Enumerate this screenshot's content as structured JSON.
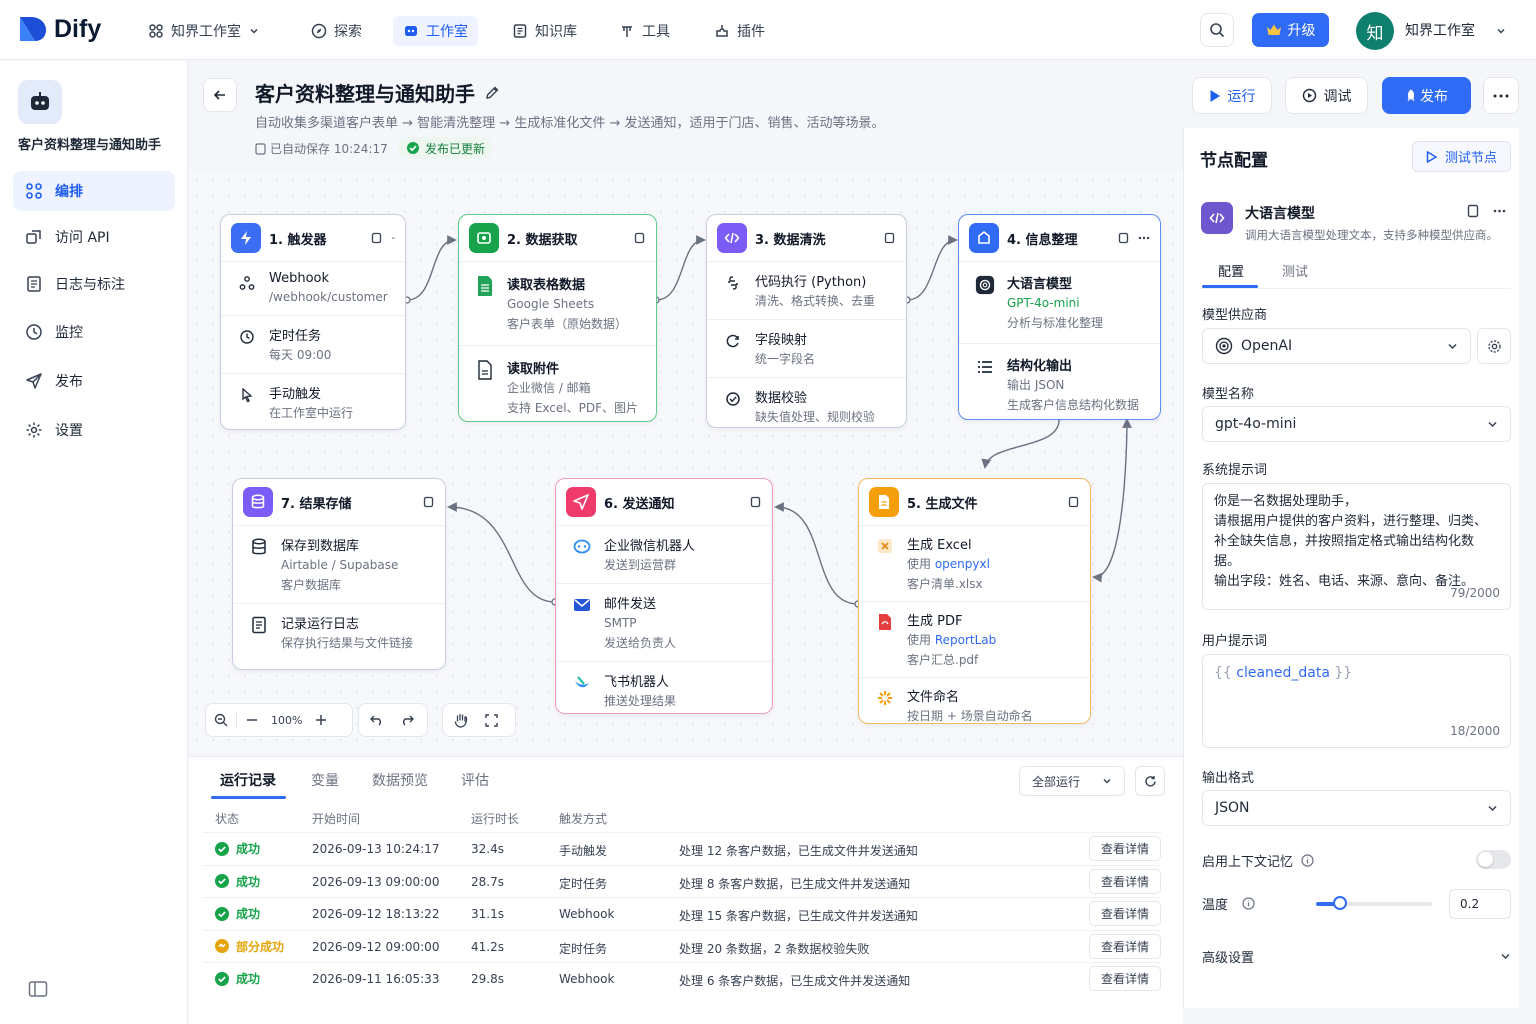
{
  "brand": {
    "name": "Dify",
    "accent": "#2f6bf5"
  },
  "topnav": {
    "workspace": "知界工作室",
    "items": [
      {
        "label": "探索"
      },
      {
        "label": "工作室"
      },
      {
        "label": "知识库"
      },
      {
        "label": "工具"
      },
      {
        "label": "插件"
      }
    ],
    "active": "工作室",
    "upgrade": "升级",
    "user_initial": "知",
    "user_name": "知界工作室"
  },
  "sidebar": {
    "app_name": "客户资料整理与通知助手",
    "items": [
      {
        "label": "编排",
        "icon": "orchestrate-icon"
      },
      {
        "label": "访问 API",
        "icon": "api-icon"
      },
      {
        "label": "日志与标注",
        "icon": "log-icon"
      },
      {
        "label": "监控",
        "icon": "monitor-icon"
      },
      {
        "label": "发布",
        "icon": "publish-icon"
      },
      {
        "label": "设置",
        "icon": "settings-icon"
      }
    ]
  },
  "header": {
    "title": "客户资料整理与通知助手",
    "description": "自动收集多渠道客户表单 → 智能清洗整理 → 生成标准化文件 → 发送通知，适用于门店、销售、活动等场景。",
    "autosave": "已自动保存 10:24:17",
    "publish_status": "发布已更新",
    "run": "运行",
    "debug": "调试",
    "publish": "发布"
  },
  "nodes": {
    "n1": {
      "title": "1. 触发器",
      "color": "#3b6ef5",
      "rows": [
        {
          "title": "Webhook",
          "sub": "/webhook/customer"
        },
        {
          "title": "定时任务",
          "sub": "每天 09:00"
        },
        {
          "title": "手动触发",
          "sub": "在工作室中运行"
        }
      ]
    },
    "n2": {
      "title": "2. 数据获取",
      "color": "#16a34a",
      "rows": [
        {
          "title": "读取表格数据",
          "sub1": "Google Sheets",
          "sub2": "客户表单（原始数据）"
        },
        {
          "title": "读取附件",
          "sub1": "企业微信 / 邮箱",
          "sub2": "支持 Excel、PDF、图片"
        }
      ]
    },
    "n3": {
      "title": "3. 数据清洗",
      "color": "#7c5cf6",
      "rows": [
        {
          "title": "代码执行 (Python)",
          "sub": "清洗、格式转换、去重"
        },
        {
          "title": "字段映射",
          "sub": "统一字段名"
        },
        {
          "title": "数据校验",
          "sub": "缺失值处理、规则校验"
        }
      ]
    },
    "n4": {
      "title": "4. 信息整理",
      "color": "#2f6bf5",
      "rows": [
        {
          "title": "大语言模型",
          "sub1": "GPT-4o-mini",
          "sub2": "分析与标准化整理"
        },
        {
          "title": "结构化输出",
          "sub1": "输出 JSON",
          "sub2": "生成客户信息结构化数据"
        }
      ]
    },
    "n5": {
      "title": "5. 生成文件",
      "color": "#f59e0b",
      "rows": [
        {
          "title": "生成 Excel",
          "sub1a": "使用 ",
          "sub1b": "openpyxl",
          "sub2": "客户清单.xlsx"
        },
        {
          "title": "生成 PDF",
          "sub1a": "使用 ",
          "sub1b": "ReportLab",
          "sub2": "客户汇总.pdf"
        },
        {
          "title": "文件命名",
          "sub": "按日期 + 场景自动命名"
        }
      ]
    },
    "n6": {
      "title": "6. 发送通知",
      "color": "#ef3b6b",
      "rows": [
        {
          "title": "企业微信机器人",
          "sub": "发送到运营群"
        },
        {
          "title": "邮件发送",
          "sub1": "SMTP",
          "sub2": "发送给负责人"
        },
        {
          "title": "飞书机器人",
          "sub": "推送处理结果"
        }
      ]
    },
    "n7": {
      "title": "7. 结果存储",
      "color": "#7c5cf6",
      "rows": [
        {
          "title": "保存到数据库",
          "sub1": "Airtable / Supabase",
          "sub2": "客户数据库"
        },
        {
          "title": "记录运行日志",
          "sub": "保存执行结果与文件链接"
        }
      ]
    }
  },
  "canvas_toolbar": {
    "zoom": "100%"
  },
  "runs": {
    "tabs": [
      {
        "label": "运行记录"
      },
      {
        "label": "变量"
      },
      {
        "label": "数据预览"
      },
      {
        "label": "评估"
      }
    ],
    "filter": "全部运行",
    "columns": [
      "状态",
      "开始时间",
      "运行时长",
      "触发方式"
    ],
    "detail_label": "查看详情",
    "rows": [
      {
        "status": "成功",
        "start": "2026-09-13 10:24:17",
        "duration": "32.4s",
        "trigger": "手动触发",
        "message": "处理 12 条客户数据，已生成文件并发送通知",
        "color": "#16a34a"
      },
      {
        "status": "成功",
        "start": "2026-09-13 09:00:00",
        "duration": "28.7s",
        "trigger": "定时任务",
        "message": "处理 8 条客户数据，已生成文件并发送通知",
        "color": "#16a34a"
      },
      {
        "status": "成功",
        "start": "2026-09-12 18:13:22",
        "duration": "31.1s",
        "trigger": "Webhook",
        "message": "处理 15 条客户数据，已生成文件并发送通知",
        "color": "#16a34a"
      },
      {
        "status": "部分成功",
        "start": "2026-09-12 09:00:00",
        "duration": "41.2s",
        "trigger": "定时任务",
        "message": "处理 20 条数据，2 条数据校验失败",
        "color": "#e5a50a"
      },
      {
        "status": "成功",
        "start": "2026-09-11 16:05:33",
        "duration": "29.8s",
        "trigger": "Webhook",
        "message": "处理 6 条客户数据，已生成文件并发送通知",
        "color": "#16a34a"
      }
    ]
  },
  "panel": {
    "title": "节点配置",
    "test_node": "测试节点",
    "node_title": "大语言模型",
    "node_desc": "调用大语言模型处理文本，支持多种模型供应商。",
    "tabs": [
      {
        "label": "配置"
      },
      {
        "label": "测试"
      }
    ],
    "provider_label": "模型供应商",
    "provider": "OpenAI",
    "model_label": "模型名称",
    "model": "gpt-4o-mini",
    "system_label": "系统提示词",
    "system_lines": [
      "你是一名数据处理助手，",
      "请根据用户提供的客户资料，进行整理、归类、",
      "补全缺失信息，并按照指定格式输出结构化数据。",
      "输出字段：姓名、电话、来源、意向、备注。"
    ],
    "system_count": "79/2000",
    "user_label": "用户提示词",
    "user_var": "cleaned_data",
    "user_count": "18/2000",
    "format_label": "输出格式",
    "format": "JSON",
    "context_label": "启用上下文记忆",
    "context_enabled": false,
    "temp_label": "温度",
    "temperature": "0.2",
    "advanced": "高级设置"
  }
}
